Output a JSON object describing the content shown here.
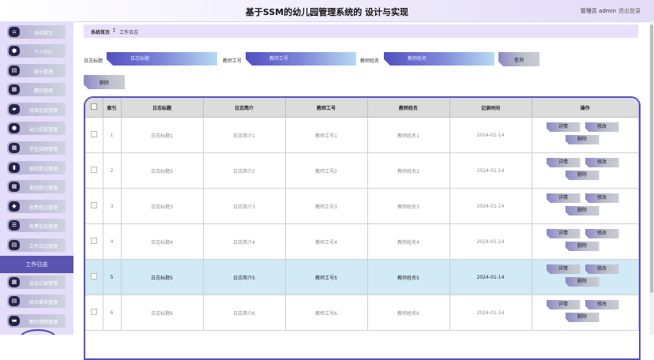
{
  "header": {
    "title": "基于SSM的幼儿园管理系统的 设计与实现",
    "user": "管理员 admin",
    "logout": "退出登录"
  },
  "sidebar": {
    "items": [
      {
        "label": "系统首页",
        "icon": "home-icon",
        "glyph": "⌂"
      },
      {
        "label": "个人中心",
        "icon": "person-icon",
        "glyph": "●"
      },
      {
        "label": "家长管理",
        "icon": "doc-icon",
        "glyph": "▤"
      },
      {
        "label": "教师管理",
        "icon": "grid-icon",
        "glyph": "▦"
      },
      {
        "label": "班级信息管理",
        "icon": "comment-icon",
        "glyph": "▰"
      },
      {
        "label": "幼儿信息管理",
        "icon": "person-icon",
        "glyph": "●"
      },
      {
        "label": "学生成绩管理",
        "icon": "grid-icon",
        "glyph": "▦"
      },
      {
        "label": "体检登记管理",
        "icon": "chart-icon",
        "glyph": "▮"
      },
      {
        "label": "离园登记管理",
        "icon": "grid-icon",
        "glyph": "▦"
      },
      {
        "label": "收费登记管理",
        "icon": "location-icon",
        "glyph": "◆"
      },
      {
        "label": "收费信息管理",
        "icon": "list-icon",
        "glyph": "☰"
      },
      {
        "label": "工作日志管理",
        "icon": "doc-icon",
        "glyph": "▤"
      }
    ],
    "active": "工作日志",
    "items_after": [
      {
        "label": "会议记录管理",
        "icon": "grid-icon",
        "glyph": "▦"
      },
      {
        "label": "综合事务管理",
        "icon": "doc-icon",
        "glyph": "▤"
      },
      {
        "label": "教师请假管理",
        "icon": "folder-icon",
        "glyph": "▬"
      }
    ]
  },
  "breadcrumb": {
    "home": "系统首页",
    "sep": "⁑",
    "current": "工作日志"
  },
  "filters": {
    "title_label": "日志标题",
    "title_placeholder": "日志标题",
    "teacher_no_label": "教师工号",
    "teacher_no_placeholder": "教师工号",
    "teacher_name_label": "教师姓名",
    "teacher_name_placeholder": "教师姓名",
    "query": "查询",
    "delete": "删除"
  },
  "table": {
    "headers": [
      "索引",
      "日志标题",
      "日志简介",
      "教师工号",
      "教师姓名",
      "记录时间",
      "操作"
    ],
    "rows": [
      {
        "idx": "1",
        "title": "日志标题1",
        "intro": "日志简介1",
        "no": "教师工号1",
        "name": "教师姓名1",
        "time": "2024-01-14"
      },
      {
        "idx": "2",
        "title": "日志标题2",
        "intro": "日志简介2",
        "no": "教师工号2",
        "name": "教师姓名2",
        "time": "2024-01-14"
      },
      {
        "idx": "3",
        "title": "日志标题3",
        "intro": "日志简介3",
        "no": "教师工号3",
        "name": "教师姓名3",
        "time": "2024-01-14"
      },
      {
        "idx": "4",
        "title": "日志标题4",
        "intro": "日志简介4",
        "no": "教师工号4",
        "name": "教师姓名4",
        "time": "2024-01-14"
      },
      {
        "idx": "5",
        "title": "日志标题5",
        "intro": "日志简介5",
        "no": "教师工号5",
        "name": "教师姓名5",
        "time": "2024-01-14"
      },
      {
        "idx": "6",
        "title": "日志标题6",
        "intro": "日志简介6",
        "no": "教师工号6",
        "name": "教师姓名6",
        "time": "2024-01-14"
      }
    ],
    "ops": {
      "detail": "详情",
      "edit": "修改",
      "delete": "删除"
    }
  }
}
